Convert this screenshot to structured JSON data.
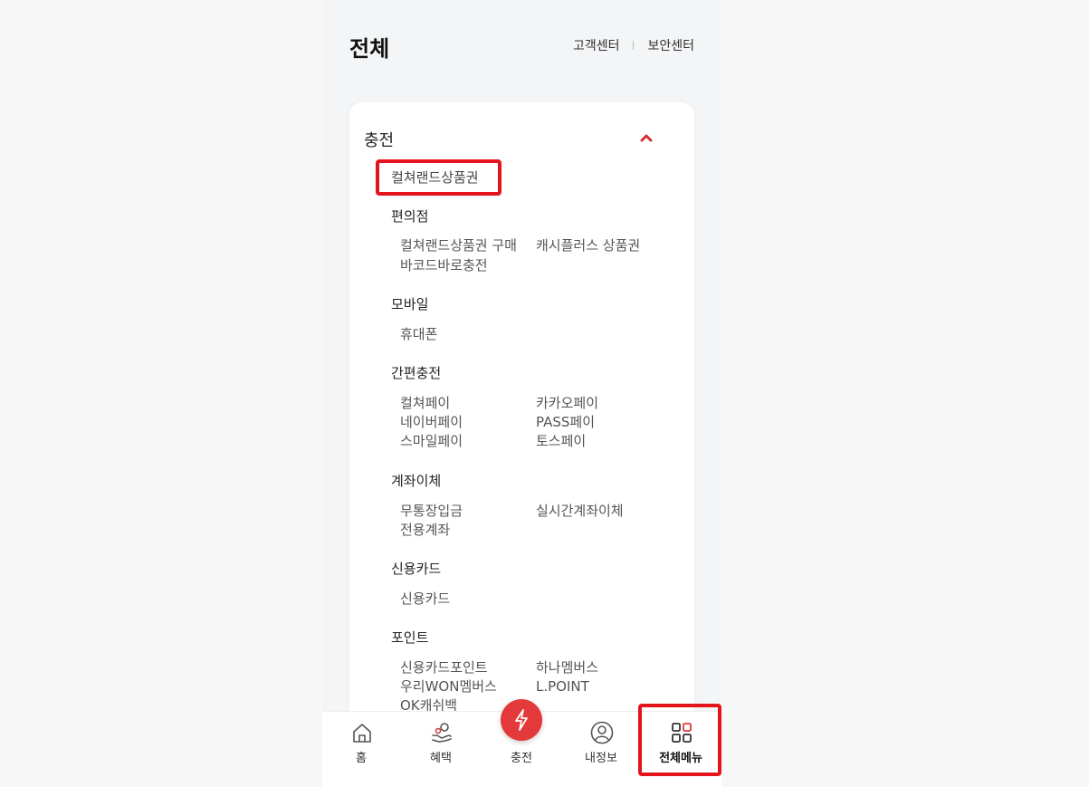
{
  "header": {
    "title": "전체",
    "link1": "고객센터",
    "link2": "보안센터"
  },
  "section": {
    "title": "충전",
    "top_item": "컬쳐랜드상품권"
  },
  "groups": [
    {
      "title": "편의점",
      "rows": [
        [
          "컬쳐랜드상품권 구매",
          "캐시플러스 상품권"
        ],
        [
          "바코드바로충전",
          ""
        ]
      ]
    },
    {
      "title": "모바일",
      "rows": [
        [
          "휴대폰",
          ""
        ]
      ]
    },
    {
      "title": "간편충전",
      "rows": [
        [
          "컬쳐페이",
          "카카오페이"
        ],
        [
          "네이버페이",
          "PASS페이"
        ],
        [
          "스마일페이",
          "토스페이"
        ]
      ]
    },
    {
      "title": "계좌이체",
      "rows": [
        [
          "무통장입금",
          "실시간계좌이체"
        ],
        [
          "전용계좌",
          ""
        ]
      ]
    },
    {
      "title": "신용카드",
      "rows": [
        [
          "신용카드",
          ""
        ]
      ]
    },
    {
      "title": "포인트",
      "rows": [
        [
          "신용카드포인트",
          "하나멤버스"
        ],
        [
          "우리WON멤버스",
          "L.POINT"
        ],
        [
          "OK캐쉬백",
          ""
        ]
      ]
    }
  ],
  "nav": {
    "home": "홈",
    "benefit": "혜택",
    "charge": "충전",
    "myinfo": "내정보",
    "allmenu": "전체메뉴"
  },
  "colors": {
    "accent": "#e3393b",
    "highlight": "#e3141c"
  }
}
